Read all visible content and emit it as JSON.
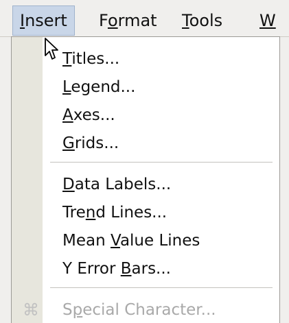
{
  "menubar": {
    "items": [
      {
        "pre": "",
        "mn": "I",
        "post": "nsert",
        "active": true
      },
      {
        "pre": "F",
        "mn": "o",
        "post": "rmat",
        "active": false
      },
      {
        "pre": "",
        "mn": "T",
        "post": "ools",
        "active": false
      },
      {
        "pre": "",
        "mn": "W",
        "post": "",
        "active": false
      }
    ]
  },
  "menu": {
    "groups": [
      {
        "items": [
          {
            "pre": "",
            "mn": "T",
            "post": "itles...",
            "enabled": true
          },
          {
            "pre": "",
            "mn": "L",
            "post": "egend...",
            "enabled": true
          },
          {
            "pre": "",
            "mn": "A",
            "post": "xes...",
            "enabled": true
          },
          {
            "pre": "",
            "mn": "G",
            "post": "rids...",
            "enabled": true
          }
        ]
      },
      {
        "items": [
          {
            "pre": "",
            "mn": "D",
            "post": "ata Labels...",
            "enabled": true
          },
          {
            "pre": "Tre",
            "mn": "n",
            "post": "d Lines...",
            "enabled": true
          },
          {
            "pre": "Mean ",
            "mn": "V",
            "post": "alue Lines",
            "enabled": true
          },
          {
            "pre": "Y Error ",
            "mn": "B",
            "post": "ars...",
            "enabled": true
          }
        ]
      },
      {
        "items": [
          {
            "pre": "S",
            "mn": "p",
            "post": "ecial Character...",
            "enabled": false,
            "icon": "command-symbol-icon"
          }
        ]
      }
    ]
  },
  "icons": {
    "special_char_glyph": "⌘"
  }
}
